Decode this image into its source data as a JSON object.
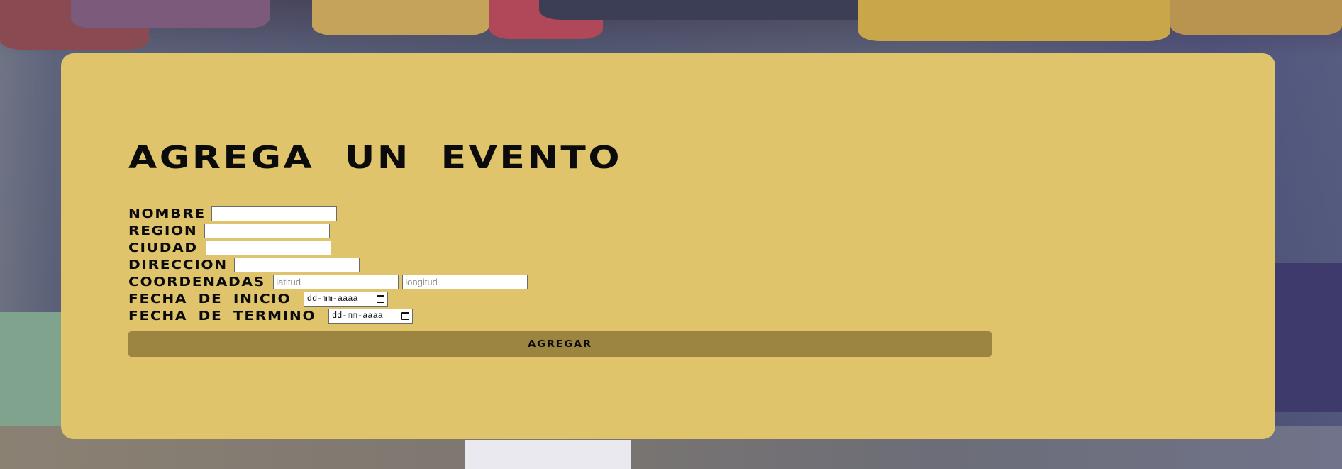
{
  "page": {
    "title": "AGREGA UN EVENTO"
  },
  "form": {
    "fields": {
      "nombre": {
        "label": "NOMBRE",
        "value": ""
      },
      "region": {
        "label": "REGION",
        "value": ""
      },
      "ciudad": {
        "label": "CIUDAD",
        "value": ""
      },
      "direccion": {
        "label": "DIRECCION",
        "value": ""
      },
      "coordenadas": {
        "label": "COORDENADAS",
        "lat_placeholder": "latitud",
        "lng_placeholder": "longitud"
      },
      "fecha_inicio": {
        "label": "FECHA DE INICIO",
        "placeholder": "dd-mm-aaaa"
      },
      "fecha_termino": {
        "label": "FECHA DE TERMINO",
        "placeholder": "dd-mm-aaaa"
      }
    },
    "submit_label": "AGREGAR"
  },
  "colors": {
    "card_background": "#dfc46c",
    "button_background": "#9c8540",
    "text": "#0b0b0b"
  },
  "icons": {
    "date_picker": "calendar-icon"
  }
}
